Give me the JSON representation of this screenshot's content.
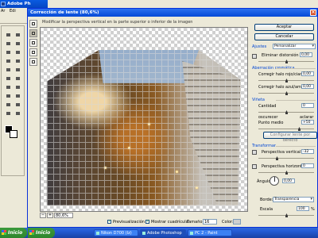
{
  "photoshop": {
    "title": "Adobe Ph",
    "menu": [
      "Ar",
      "Edi"
    ]
  },
  "dialog": {
    "title": "Corrección de lente (80,6%)",
    "instruction": "Modificar la perspectiva vertical en la parte superior o inferior de la imagen",
    "zoom_value": "80,6%",
    "zoom_minus": "−",
    "zoom_plus": "+"
  },
  "bottom": {
    "preview_label": "Previsualización",
    "grid_label": "Mostrar cuadrícula",
    "size_label": "Tamaño:",
    "size_value": "16",
    "color_label": "Color:"
  },
  "panel": {
    "ok": "Aceptar",
    "cancel": "Cancelar",
    "settings_label": "Ajustes",
    "settings_value": "Personalizar",
    "distortion_label": "Eliminar distorsión",
    "distortion_value": "0,00",
    "chromatic_label": "Aberración cromática",
    "chrom_red_cyan": "Corregir halo rojo/cian",
    "chrom_red_cyan_value": "0,00",
    "chrom_blue_yellow": "Corregir halo azul/amarillo",
    "chrom_blue_yellow_value": "0,00",
    "vignette_label": "Viñeta",
    "amount_label": "Cantidad",
    "amount_value": "0",
    "darken": "oscurecer",
    "lighten": "aclarar",
    "midpoint_label": "Punto medio",
    "midpoint_value": "+50",
    "default_lens_button": "Configurar lente por defecto",
    "transform_label": "Transformar",
    "vertical_label": "Perspectiva vertical",
    "vertical_value": "-32",
    "horizontal_label": "Perspectiva horizontal",
    "horizontal_value": "0",
    "angle_label": "Ángulo:",
    "angle_value": "0,00",
    "edge_label": "Borde:",
    "edge_value": "Transparencia",
    "scale_label": "Escala",
    "scale_value": "100",
    "scale_unit": "%"
  },
  "taskbar": {
    "start1": "Inicio",
    "start2": "Inicio",
    "tasks": [
      "Nikon D700 (Iz)",
      "Adobe Photoshop",
      "PC 2 - Paint"
    ]
  }
}
